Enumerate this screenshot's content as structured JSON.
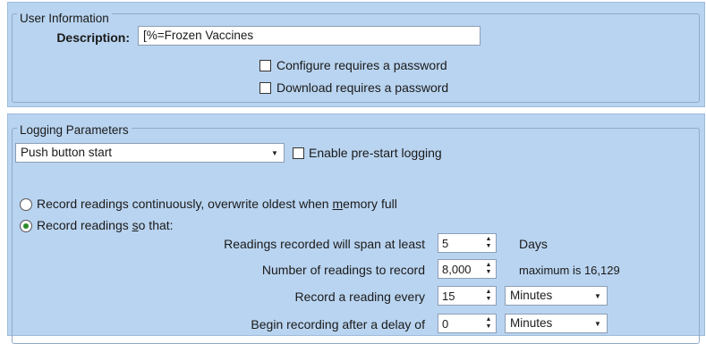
{
  "user_info": {
    "legend": "User Information",
    "description_label": "Description:",
    "description_value": "[%=Frozen Vaccines",
    "configure_pw_label": "Configure requires a password",
    "configure_pw_checked": false,
    "download_pw_label": "Download requires a password",
    "download_pw_checked": false
  },
  "logging": {
    "legend": "Logging Parameters",
    "start_mode": "Push button start",
    "prestart_label_a": "Enable pre-start lo",
    "prestart_label_u": "g",
    "prestart_label_b": "ging",
    "prestart_checked": false,
    "radio_continuous_a": "Record readings continuously, overwrite oldest when ",
    "radio_continuous_u": "m",
    "radio_continuous_b": "emory full",
    "radio_continuous_selected": false,
    "radio_so_that_a": "Record readings ",
    "radio_so_that_u": "s",
    "radio_so_that_b": "o that:",
    "radio_so_that_selected": true,
    "rows": {
      "span": {
        "label": "Readings recorded will span at least",
        "value": "5",
        "suffix": "Days"
      },
      "count": {
        "label": "Number of readings to record",
        "value": "8,000",
        "suffix": "maximum is 16,129"
      },
      "every": {
        "label": "Record a reading every",
        "value": "15",
        "unit": "Minutes"
      },
      "delay": {
        "label": "Begin recording after a delay of",
        "value": "0",
        "unit": "Minutes"
      }
    }
  }
}
